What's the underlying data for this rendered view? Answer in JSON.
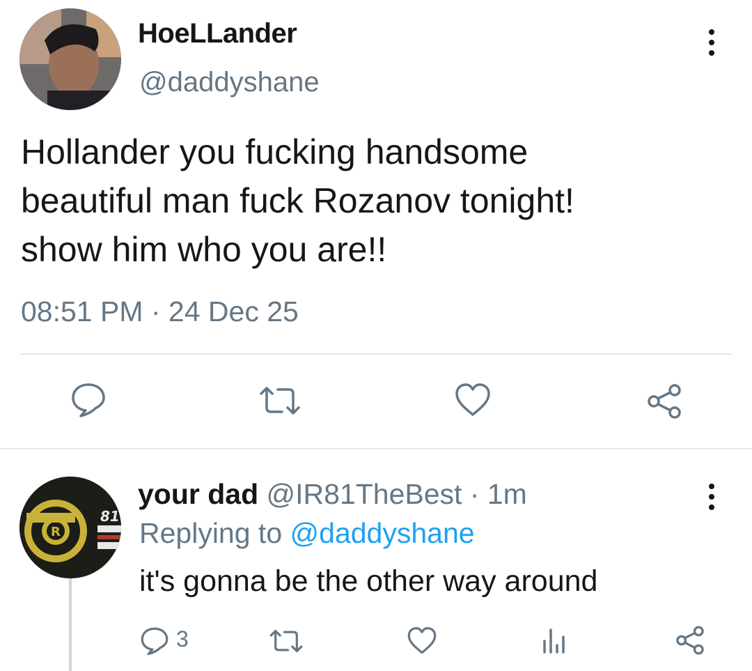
{
  "tweet": {
    "display_name": "HoeLLander",
    "handle": "@daddyshane",
    "text": "Hollander you fucking handsome\nbeautiful man fuck Rozanov tonight!\nshow him who you are!!",
    "timestamp": "08:51 PM · 24 Dec 25",
    "actions": [
      "reply-icon",
      "retweet-icon",
      "like-icon",
      "share-icon"
    ]
  },
  "reply": {
    "display_name": "your dad",
    "handle_time": " @IR81TheBest · 1m",
    "replying_prefix": "Replying to ",
    "replying_to": "@daddyshane",
    "text": "it's gonna be the other way around",
    "reply_count": "3",
    "actions": [
      "reply-icon",
      "retweet-icon",
      "like-icon",
      "analytics-icon",
      "share-icon"
    ]
  },
  "colors": {
    "text": "#14171a",
    "secondary": "#657786",
    "accent": "#1da1f2",
    "divider": "#e1e8ed"
  }
}
